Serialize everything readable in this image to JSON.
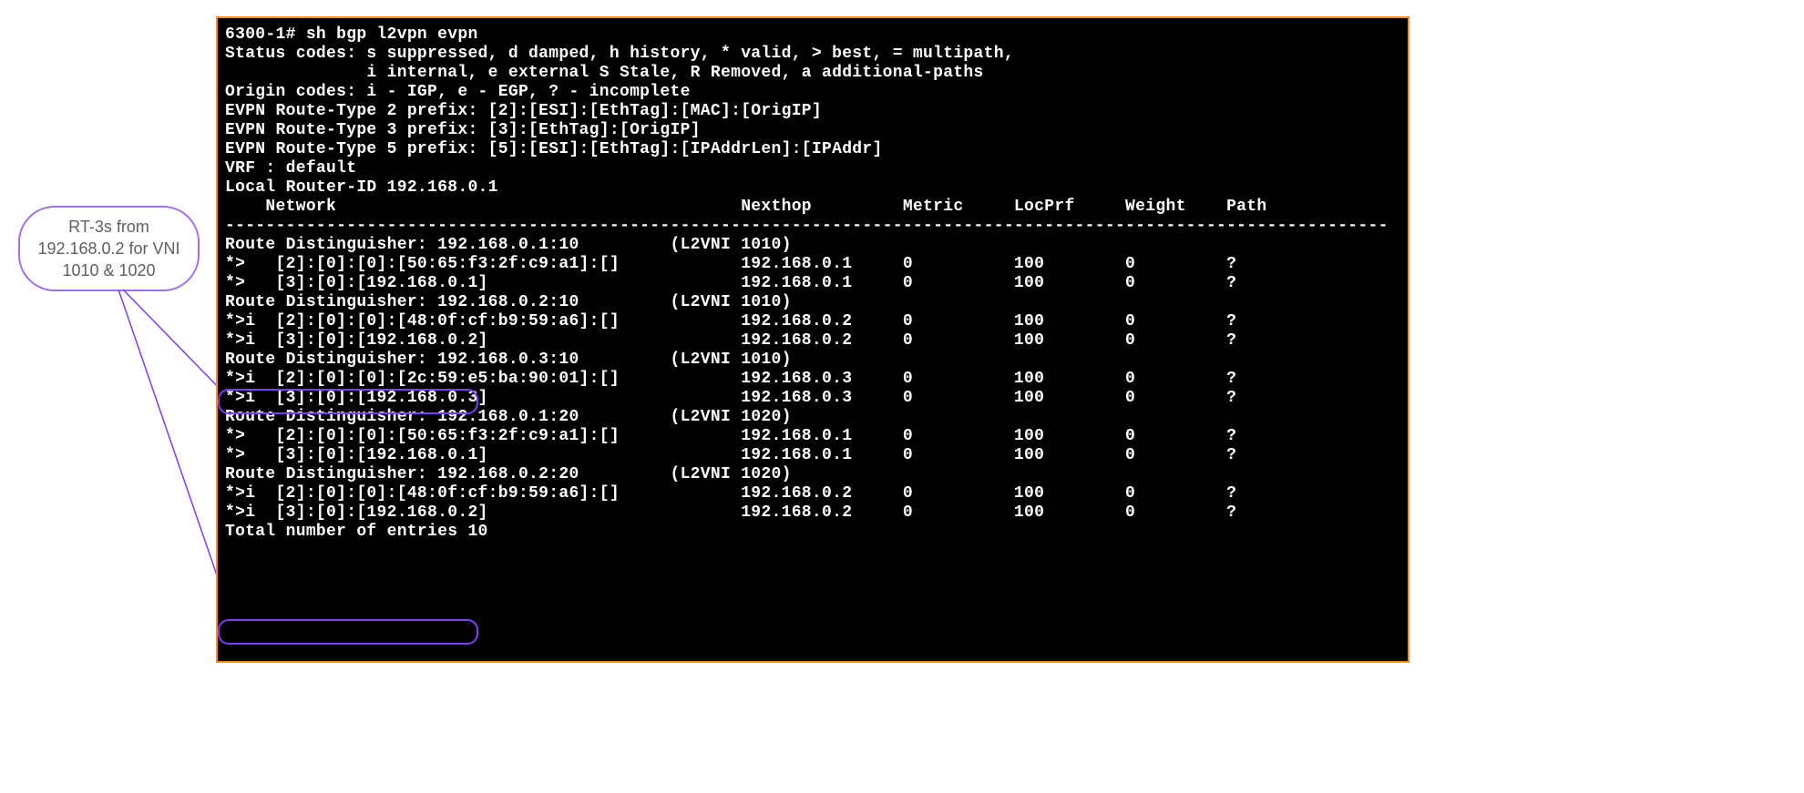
{
  "callout": {
    "line1": "RT-3s from",
    "line2": "192.168.0.2 for VNI",
    "line3": "1010 & 1020"
  },
  "terminal": {
    "prompt": "6300-1#",
    "command": "sh bgp l2vpn evpn",
    "status_line1": "Status codes: s suppressed, d damped, h history, * valid, > best, = multipath,",
    "status_line2": "              i internal, e external S Stale, R Removed, a additional-paths",
    "origin_line": "Origin codes: i - IGP, e - EGP, ? - incomplete",
    "rt2_prefix": "EVPN Route-Type 2 prefix: [2]:[ESI]:[EthTag]:[MAC]:[OrigIP]",
    "rt3_prefix": "EVPN Route-Type 3 prefix: [3]:[EthTag]:[OrigIP]",
    "rt5_prefix": "EVPN Route-Type 5 prefix: [5]:[ESI]:[EthTag]:[IPAddrLen]:[IPAddr]",
    "vrf": "VRF : default",
    "router_id": "Local Router-ID 192.168.0.1",
    "header": "    Network                                        Nexthop         Metric     LocPrf     Weight    Path",
    "divider": "-------------------------------------------------------------------------------------------------------------------",
    "groups": [
      {
        "rd": "Route Distinguisher: 192.168.0.1:10         (L2VNI 1010)",
        "routes": [
          {
            "net": "*>   [2]:[0]:[0]:[50:65:f3:2f:c9:a1]:[]",
            "nexthop": "192.168.0.1",
            "metric": "0",
            "locprf": "100",
            "weight": "0",
            "path": "?"
          },
          {
            "net": "*>   [3]:[0]:[192.168.0.1]",
            "nexthop": "192.168.0.1",
            "metric": "0",
            "locprf": "100",
            "weight": "0",
            "path": "?"
          }
        ]
      },
      {
        "rd": "Route Distinguisher: 192.168.0.2:10         (L2VNI 1010)",
        "routes": [
          {
            "net": "*>i  [2]:[0]:[0]:[48:0f:cf:b9:59:a6]:[]",
            "nexthop": "192.168.0.2",
            "metric": "0",
            "locprf": "100",
            "weight": "0",
            "path": "?"
          },
          {
            "net": "*>i  [3]:[0]:[192.168.0.2]",
            "nexthop": "192.168.0.2",
            "metric": "0",
            "locprf": "100",
            "weight": "0",
            "path": "?"
          }
        ]
      },
      {
        "rd": "Route Distinguisher: 192.168.0.3:10         (L2VNI 1010)",
        "routes": [
          {
            "net": "*>i  [2]:[0]:[0]:[2c:59:e5:ba:90:01]:[]",
            "nexthop": "192.168.0.3",
            "metric": "0",
            "locprf": "100",
            "weight": "0",
            "path": "?"
          },
          {
            "net": "*>i  [3]:[0]:[192.168.0.3]",
            "nexthop": "192.168.0.3",
            "metric": "0",
            "locprf": "100",
            "weight": "0",
            "path": "?"
          }
        ]
      },
      {
        "rd": "Route Distinguisher: 192.168.0.1:20         (L2VNI 1020)",
        "routes": [
          {
            "net": "*>   [2]:[0]:[0]:[50:65:f3:2f:c9:a1]:[]",
            "nexthop": "192.168.0.1",
            "metric": "0",
            "locprf": "100",
            "weight": "0",
            "path": "?"
          },
          {
            "net": "*>   [3]:[0]:[192.168.0.1]",
            "nexthop": "192.168.0.1",
            "metric": "0",
            "locprf": "100",
            "weight": "0",
            "path": "?"
          }
        ]
      },
      {
        "rd": "Route Distinguisher: 192.168.0.2:20         (L2VNI 1020)",
        "routes": [
          {
            "net": "*>i  [2]:[0]:[0]:[48:0f:cf:b9:59:a6]:[]",
            "nexthop": "192.168.0.2",
            "metric": "0",
            "locprf": "100",
            "weight": "0",
            "path": "?"
          },
          {
            "net": "*>i  [3]:[0]:[192.168.0.2]",
            "nexthop": "192.168.0.2",
            "metric": "0",
            "locprf": "100",
            "weight": "0",
            "path": "?"
          }
        ]
      }
    ],
    "total": "Total number of entries 10"
  }
}
